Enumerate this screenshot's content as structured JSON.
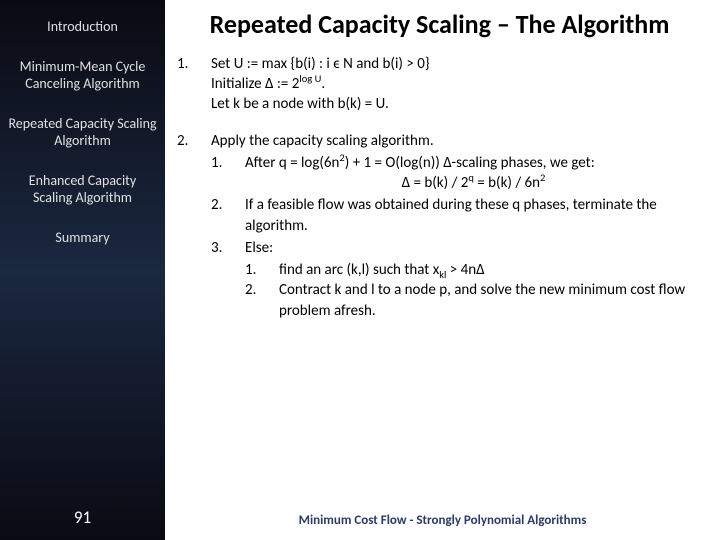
{
  "sidebar": {
    "items": [
      "Introduction",
      "Minimum-Mean Cycle Canceling Algorithm",
      "Repeated Capacity Scaling Algorithm",
      "Enhanced Capacity Scaling Algorithm",
      "Summary"
    ],
    "page_number": "91"
  },
  "main": {
    "title": "Repeated Capacity Scaling – The Algorithm",
    "step1_line1": "Set U := max {b(i) : i ϵ N and b(i) > 0}",
    "step1_line2_a": "Initialize Δ := 2",
    "step1_line2_sup": "log U",
    "step1_line2_b": ".",
    "step1_line3": "Let k be a node with b(k) = U.",
    "step2_intro": "Apply the capacity scaling algorithm.",
    "step2_1a": "After q = log(6n",
    "step2_1b": ") + 1 = O(log(n))  Δ-scaling phases, we get:",
    "step2_1_center_a": "Δ = b(k) / 2",
    "step2_1_center_b": " = b(k) / 6n",
    "step2_2": "If a feasible flow was obtained during these q phases, terminate the algorithm.",
    "step2_3": "Else:",
    "step2_3_1a": "find an arc (k,l) such that x",
    "step2_3_1sub": "kl",
    "step2_3_1b": " > 4nΔ",
    "step2_3_2": "Contract k and l to a node p, and solve the new minimum cost flow problem afresh.",
    "footer": "Minimum Cost Flow - Strongly Polynomial Algorithms"
  }
}
